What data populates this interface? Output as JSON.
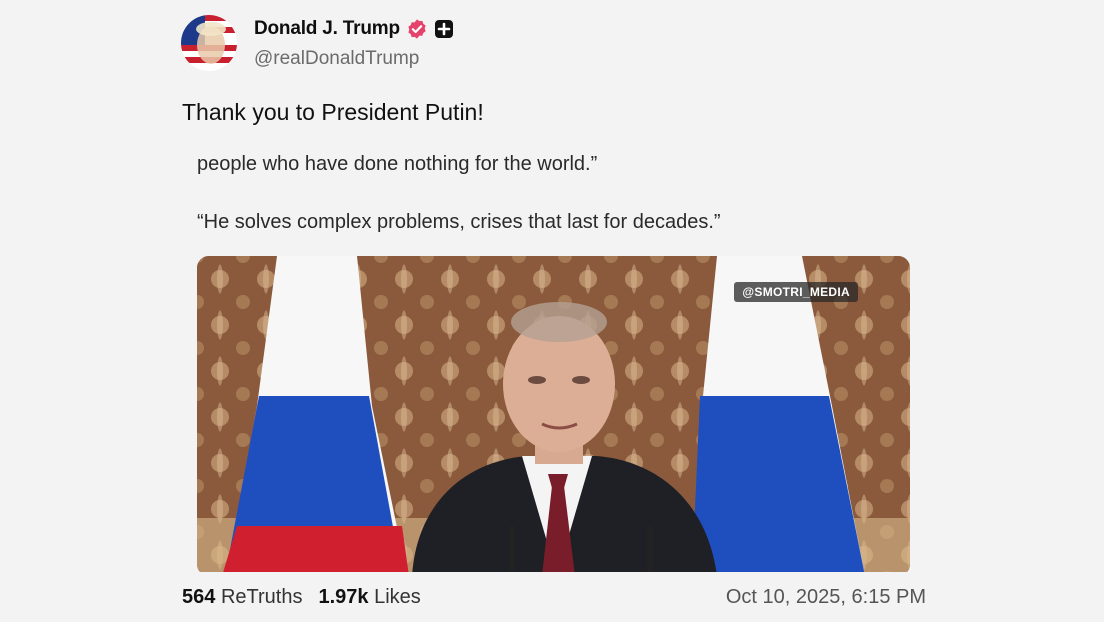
{
  "author": {
    "display_name": "Donald J. Trump",
    "handle": "@realDonaldTrump"
  },
  "post": {
    "text": "Thank you to President Putin!"
  },
  "media": {
    "quote_lines": [
      "people who have done nothing for the world.”",
      "“He solves complex problems, crises that last for decades.”"
    ],
    "watermark": "@SMOTRI_MEDIA"
  },
  "stats": {
    "retruths_count": "564",
    "retruths_label": "ReTruths",
    "likes_count": "1.97k",
    "likes_label": "Likes"
  },
  "timestamp": "Oct 10, 2025, 6:15 PM",
  "colors": {
    "verified": "#e5436b",
    "background": "#f3f3f3"
  }
}
